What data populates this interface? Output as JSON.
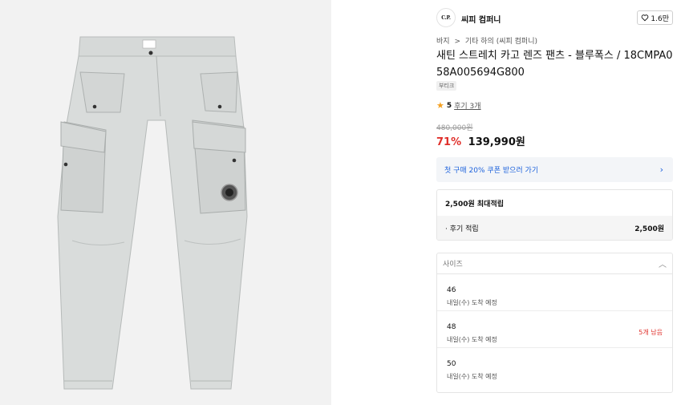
{
  "brand": {
    "logo_text": "C.P.",
    "name": "씨피 컴퍼니",
    "likes": "1.6만"
  },
  "breadcrumb": [
    "바지",
    ">",
    "기타 하의 (씨피 컴퍼니)"
  ],
  "product": {
    "title": "새틴 스트레치 카고 렌즈 팬츠 - 블루폭스 / 18CMPA058A005694G800",
    "tag": "부티크",
    "rating": "5",
    "reviews": "후기 3개",
    "original_price": "480,000원",
    "discount": "71%",
    "sale_price": "139,990원"
  },
  "coupon": {
    "label": "첫 구매 20% 쿠폰 받으러 가기",
    "chevron": "›"
  },
  "points": {
    "max_label": "2,500원 최대적립",
    "review_label": "· 후기 적립",
    "review_amount": "2,500원"
  },
  "size": {
    "placeholder": "사이즈",
    "options": [
      {
        "size": "46",
        "arrival": "내일(수) 도착 예정",
        "stock": ""
      },
      {
        "size": "48",
        "arrival": "내일(수) 도착 예정",
        "stock": "5개 남음"
      },
      {
        "size": "50",
        "arrival": "내일(수) 도착 예정",
        "stock": ""
      }
    ]
  },
  "colors": {
    "accent_red": "#e0312c",
    "coupon_blue": "#1d62dc",
    "star": "#f4a020",
    "pants": "#d9dcdb"
  }
}
